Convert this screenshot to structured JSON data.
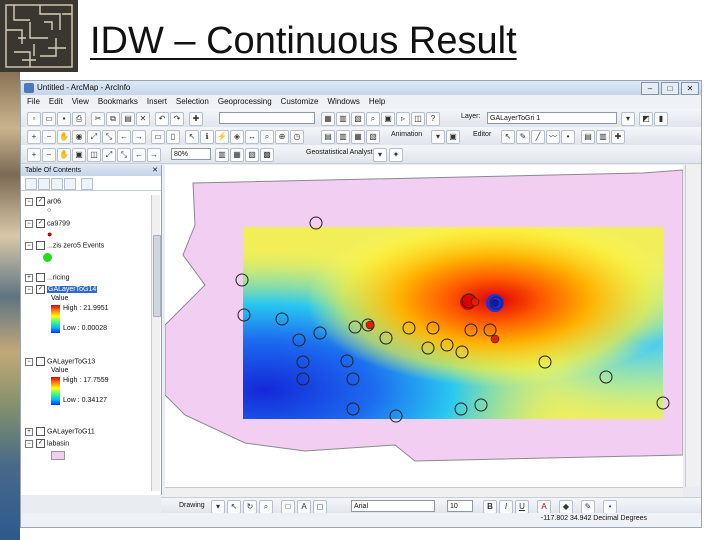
{
  "slide": {
    "title": "IDW – Continuous Result"
  },
  "app": {
    "window_title": "Untitled - ArcMap - ArcInfo",
    "menus": [
      "File",
      "Edit",
      "View",
      "Bookmarks",
      "Insert",
      "Selection",
      "Geoprocessing",
      "Customize",
      "Windows",
      "Help"
    ],
    "toolbar": {
      "scale_value": "",
      "layer_label": "Layer:",
      "layer_value": "GALayerToGri 1",
      "animation_label": "Animation",
      "editor_label": "Editor",
      "zoom_value": "80%",
      "geostat_label": "Geostatistical Analyst"
    },
    "toc": {
      "title": "Table Of Contents",
      "layers": [
        {
          "name": "ar06",
          "checked": true
        },
        {
          "name": "ca9799",
          "checked": true
        },
        {
          "name": "...zis zero5 Events",
          "checked": false
        },
        {
          "name": "...ricing",
          "checked": false
        },
        {
          "name": "GALayerToG14",
          "checked": true,
          "selected": true,
          "value_label": "Value",
          "high": "High : 21.9951",
          "low": "Low : 0.00028"
        },
        {
          "name": "GALayerToG13",
          "checked": false,
          "value_label": "Value",
          "high": "High : 17.7559",
          "low": "Low : 0.34127"
        },
        {
          "name": "GALayerToG11",
          "checked": false
        },
        {
          "name": "labasin",
          "checked": true
        }
      ]
    },
    "drawing": {
      "label": "Drawing",
      "font": "Arial",
      "size": "10",
      "bold": "B",
      "italic": "I",
      "underline": "U",
      "font_color": "A"
    },
    "status": {
      "coords": "-117.802  34.942 Decimal Degrees"
    }
  },
  "colors": {
    "basin": "#f2cff2",
    "outline": "#8a8a8a",
    "ramp_high": "#e00000",
    "ramp_low": "#1c35e0"
  }
}
